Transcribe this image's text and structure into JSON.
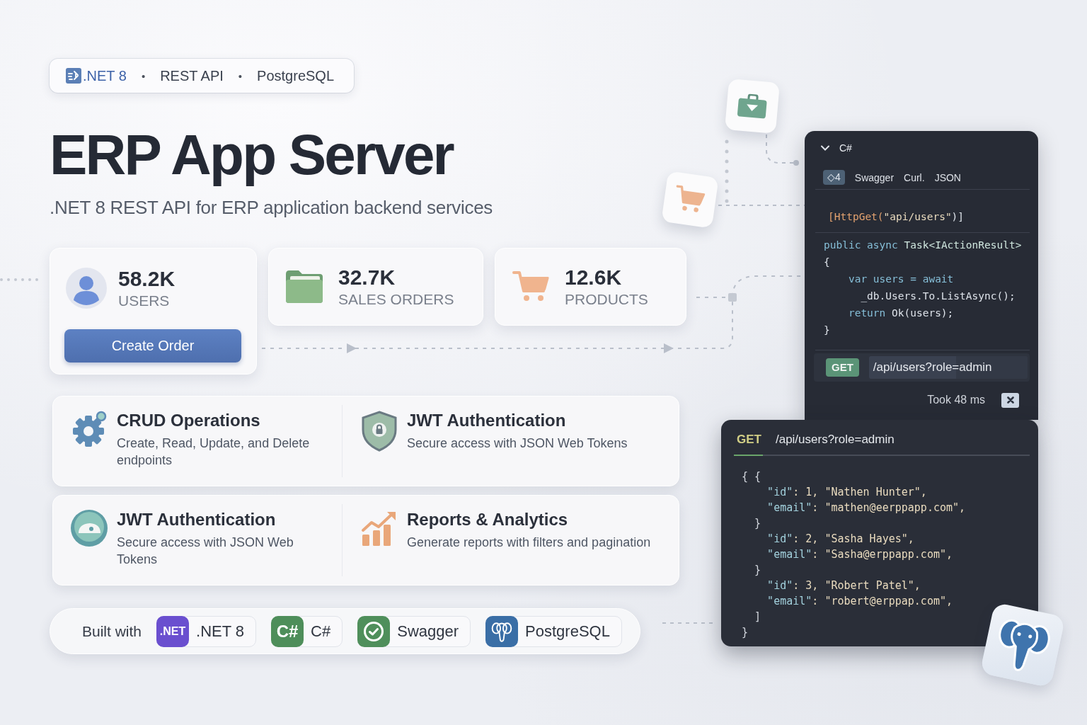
{
  "header_pill": {
    "separator": "•",
    "items": [
      {
        "kind": "brand",
        "text": ".NET 8"
      },
      {
        "kind": "plain",
        "text": "REST API"
      },
      {
        "kind": "plain",
        "text": "PostgreSQL"
      }
    ]
  },
  "title": "ERP App Server",
  "subtitle": ".NET 8 REST API for ERP application backend services",
  "stats": [
    {
      "value": "58.2K",
      "label": "USERS",
      "button": "Create Order"
    },
    {
      "value": "32.7K",
      "label": "SALES ORDERS"
    },
    {
      "value": "12.6K",
      "label": "PRODUCTS"
    }
  ],
  "feature_rows": [
    {
      "items": [
        {
          "title": "CRUD Operations",
          "description": "Create, Read, Update, and Delete endpoints"
        },
        {
          "title": "JWT Authentication",
          "description": "Secure access with JSON Web Tokens"
        }
      ]
    },
    {
      "items": [
        {
          "title": "JWT Authentication",
          "description": "Secure access with JSON Web Tokens"
        },
        {
          "title": "Reports & Analytics",
          "description": "Generate reports with filters and pagination"
        }
      ]
    }
  ],
  "built_with": {
    "label": "Built with",
    "chips": [
      {
        "kind": "text",
        "logo": ".NET",
        "color": "#6a4fcf",
        "label": ".NET 8"
      },
      {
        "kind": "text",
        "logo": "C#",
        "color": "#4e8e5a",
        "label": "C#"
      },
      {
        "kind": "check",
        "color": "#4f8f5b",
        "label": "Swagger"
      },
      {
        "kind": "elephant",
        "color": "#3a6ea6",
        "label": "PostgreSQL"
      }
    ]
  },
  "code_panel": {
    "language": "C#",
    "badge": "◇4",
    "links": [
      "Swagger",
      "Curl.",
      "JSON"
    ],
    "blocks": [
      {
        "lines": [
          {
            "tokens": [
              {
                "kind": "attr",
                "text": "[HttpGet("
              },
              {
                "kind": "string",
                "text": "\"api/users\""
              },
              {
                "kind": "plain",
                "text": ")]"
              }
            ]
          }
        ]
      },
      {
        "lines": [
          {
            "tokens": [
              {
                "kind": "keyword",
                "text": "public async "
              },
              {
                "kind": "type",
                "text": "Task<IActionResult>"
              }
            ]
          },
          {
            "tokens": [
              {
                "kind": "plain",
                "text": "{"
              }
            ]
          },
          {
            "tokens": [
              {
                "kind": "keyword",
                "text": "    var users = await"
              }
            ]
          },
          {
            "tokens": [
              {
                "kind": "plain",
                "text": "      _db.Users.To.ListAsync();"
              }
            ]
          },
          {
            "tokens": [
              {
                "kind": "keyword",
                "text": "    return "
              },
              {
                "kind": "plain",
                "text": "Ok(users);"
              }
            ]
          },
          {
            "tokens": [
              {
                "kind": "plain",
                "text": "}"
              }
            ]
          }
        ]
      }
    ],
    "request": {
      "method": "GET",
      "url": "/api/users?role=admin"
    },
    "timing": "Took 48 ms"
  },
  "response_panel": {
    "method": "GET",
    "url": "/api/users?role=admin",
    "lines": [
      {
        "tokens": [
          {
            "kind": "punct",
            "text": "{ {"
          }
        ]
      },
      {
        "tokens": [
          {
            "kind": "key",
            "text": "    \"id\""
          },
          {
            "kind": "string",
            "text": ": 1, \"Nathen Hunter\","
          }
        ]
      },
      {
        "tokens": [
          {
            "kind": "key",
            "text": "    \"email\""
          },
          {
            "kind": "string",
            "text": ": \"mathen@eerppapp.com\","
          }
        ]
      },
      {
        "tokens": [
          {
            "kind": "punct",
            "text": "  }"
          }
        ]
      },
      {
        "tokens": [
          {
            "kind": "key",
            "text": "    \"id\""
          },
          {
            "kind": "string",
            "text": ": 2, \"Sasha Hayes\","
          }
        ]
      },
      {
        "tokens": [
          {
            "kind": "key",
            "text": "    \"email\""
          },
          {
            "kind": "string",
            "text": ": \"Sasha@erppapp.com\","
          }
        ]
      },
      {
        "tokens": [
          {
            "kind": "punct",
            "text": "  }"
          }
        ]
      },
      {
        "tokens": [
          {
            "kind": "key",
            "text": "    \"id\""
          },
          {
            "kind": "string",
            "text": ": 3, \"Robert Patel\","
          }
        ]
      },
      {
        "tokens": [
          {
            "kind": "key",
            "text": "    \"email\""
          },
          {
            "kind": "string",
            "text": ": \"robert@erppap.com\","
          }
        ]
      },
      {
        "tokens": [
          {
            "kind": "punct",
            "text": "  ]"
          }
        ]
      },
      {
        "tokens": [
          {
            "kind": "punct",
            "text": "}"
          }
        ]
      }
    ]
  }
}
